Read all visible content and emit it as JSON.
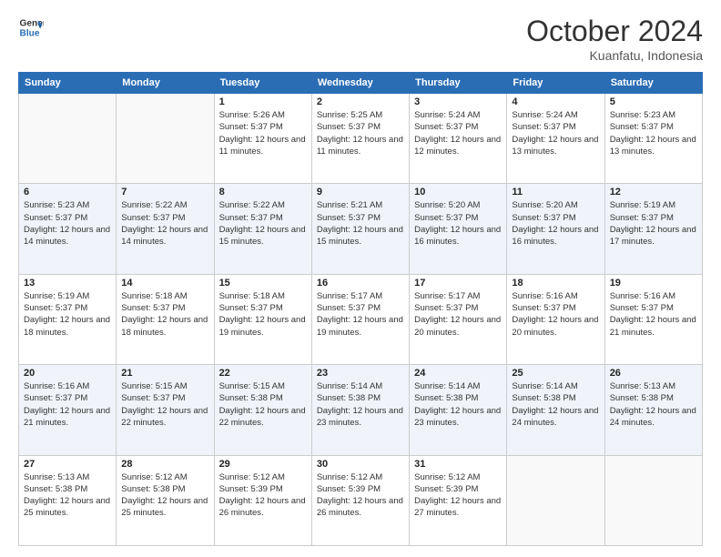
{
  "logo": {
    "line1": "General",
    "line2": "Blue"
  },
  "title": "October 2024",
  "location": "Kuanfatu, Indonesia",
  "days_of_week": [
    "Sunday",
    "Monday",
    "Tuesday",
    "Wednesday",
    "Thursday",
    "Friday",
    "Saturday"
  ],
  "weeks": [
    [
      {
        "day": "",
        "sunrise": "",
        "sunset": "",
        "daylight": ""
      },
      {
        "day": "",
        "sunrise": "",
        "sunset": "",
        "daylight": ""
      },
      {
        "day": "1",
        "sunrise": "Sunrise: 5:26 AM",
        "sunset": "Sunset: 5:37 PM",
        "daylight": "Daylight: 12 hours and 11 minutes."
      },
      {
        "day": "2",
        "sunrise": "Sunrise: 5:25 AM",
        "sunset": "Sunset: 5:37 PM",
        "daylight": "Daylight: 12 hours and 11 minutes."
      },
      {
        "day": "3",
        "sunrise": "Sunrise: 5:24 AM",
        "sunset": "Sunset: 5:37 PM",
        "daylight": "Daylight: 12 hours and 12 minutes."
      },
      {
        "day": "4",
        "sunrise": "Sunrise: 5:24 AM",
        "sunset": "Sunset: 5:37 PM",
        "daylight": "Daylight: 12 hours and 13 minutes."
      },
      {
        "day": "5",
        "sunrise": "Sunrise: 5:23 AM",
        "sunset": "Sunset: 5:37 PM",
        "daylight": "Daylight: 12 hours and 13 minutes."
      }
    ],
    [
      {
        "day": "6",
        "sunrise": "Sunrise: 5:23 AM",
        "sunset": "Sunset: 5:37 PM",
        "daylight": "Daylight: 12 hours and 14 minutes."
      },
      {
        "day": "7",
        "sunrise": "Sunrise: 5:22 AM",
        "sunset": "Sunset: 5:37 PM",
        "daylight": "Daylight: 12 hours and 14 minutes."
      },
      {
        "day": "8",
        "sunrise": "Sunrise: 5:22 AM",
        "sunset": "Sunset: 5:37 PM",
        "daylight": "Daylight: 12 hours and 15 minutes."
      },
      {
        "day": "9",
        "sunrise": "Sunrise: 5:21 AM",
        "sunset": "Sunset: 5:37 PM",
        "daylight": "Daylight: 12 hours and 15 minutes."
      },
      {
        "day": "10",
        "sunrise": "Sunrise: 5:20 AM",
        "sunset": "Sunset: 5:37 PM",
        "daylight": "Daylight: 12 hours and 16 minutes."
      },
      {
        "day": "11",
        "sunrise": "Sunrise: 5:20 AM",
        "sunset": "Sunset: 5:37 PM",
        "daylight": "Daylight: 12 hours and 16 minutes."
      },
      {
        "day": "12",
        "sunrise": "Sunrise: 5:19 AM",
        "sunset": "Sunset: 5:37 PM",
        "daylight": "Daylight: 12 hours and 17 minutes."
      }
    ],
    [
      {
        "day": "13",
        "sunrise": "Sunrise: 5:19 AM",
        "sunset": "Sunset: 5:37 PM",
        "daylight": "Daylight: 12 hours and 18 minutes."
      },
      {
        "day": "14",
        "sunrise": "Sunrise: 5:18 AM",
        "sunset": "Sunset: 5:37 PM",
        "daylight": "Daylight: 12 hours and 18 minutes."
      },
      {
        "day": "15",
        "sunrise": "Sunrise: 5:18 AM",
        "sunset": "Sunset: 5:37 PM",
        "daylight": "Daylight: 12 hours and 19 minutes."
      },
      {
        "day": "16",
        "sunrise": "Sunrise: 5:17 AM",
        "sunset": "Sunset: 5:37 PM",
        "daylight": "Daylight: 12 hours and 19 minutes."
      },
      {
        "day": "17",
        "sunrise": "Sunrise: 5:17 AM",
        "sunset": "Sunset: 5:37 PM",
        "daylight": "Daylight: 12 hours and 20 minutes."
      },
      {
        "day": "18",
        "sunrise": "Sunrise: 5:16 AM",
        "sunset": "Sunset: 5:37 PM",
        "daylight": "Daylight: 12 hours and 20 minutes."
      },
      {
        "day": "19",
        "sunrise": "Sunrise: 5:16 AM",
        "sunset": "Sunset: 5:37 PM",
        "daylight": "Daylight: 12 hours and 21 minutes."
      }
    ],
    [
      {
        "day": "20",
        "sunrise": "Sunrise: 5:16 AM",
        "sunset": "Sunset: 5:37 PM",
        "daylight": "Daylight: 12 hours and 21 minutes."
      },
      {
        "day": "21",
        "sunrise": "Sunrise: 5:15 AM",
        "sunset": "Sunset: 5:37 PM",
        "daylight": "Daylight: 12 hours and 22 minutes."
      },
      {
        "day": "22",
        "sunrise": "Sunrise: 5:15 AM",
        "sunset": "Sunset: 5:38 PM",
        "daylight": "Daylight: 12 hours and 22 minutes."
      },
      {
        "day": "23",
        "sunrise": "Sunrise: 5:14 AM",
        "sunset": "Sunset: 5:38 PM",
        "daylight": "Daylight: 12 hours and 23 minutes."
      },
      {
        "day": "24",
        "sunrise": "Sunrise: 5:14 AM",
        "sunset": "Sunset: 5:38 PM",
        "daylight": "Daylight: 12 hours and 23 minutes."
      },
      {
        "day": "25",
        "sunrise": "Sunrise: 5:14 AM",
        "sunset": "Sunset: 5:38 PM",
        "daylight": "Daylight: 12 hours and 24 minutes."
      },
      {
        "day": "26",
        "sunrise": "Sunrise: 5:13 AM",
        "sunset": "Sunset: 5:38 PM",
        "daylight": "Daylight: 12 hours and 24 minutes."
      }
    ],
    [
      {
        "day": "27",
        "sunrise": "Sunrise: 5:13 AM",
        "sunset": "Sunset: 5:38 PM",
        "daylight": "Daylight: 12 hours and 25 minutes."
      },
      {
        "day": "28",
        "sunrise": "Sunrise: 5:12 AM",
        "sunset": "Sunset: 5:38 PM",
        "daylight": "Daylight: 12 hours and 25 minutes."
      },
      {
        "day": "29",
        "sunrise": "Sunrise: 5:12 AM",
        "sunset": "Sunset: 5:39 PM",
        "daylight": "Daylight: 12 hours and 26 minutes."
      },
      {
        "day": "30",
        "sunrise": "Sunrise: 5:12 AM",
        "sunset": "Sunset: 5:39 PM",
        "daylight": "Daylight: 12 hours and 26 minutes."
      },
      {
        "day": "31",
        "sunrise": "Sunrise: 5:12 AM",
        "sunset": "Sunset: 5:39 PM",
        "daylight": "Daylight: 12 hours and 27 minutes."
      },
      {
        "day": "",
        "sunrise": "",
        "sunset": "",
        "daylight": ""
      },
      {
        "day": "",
        "sunrise": "",
        "sunset": "",
        "daylight": ""
      }
    ]
  ]
}
